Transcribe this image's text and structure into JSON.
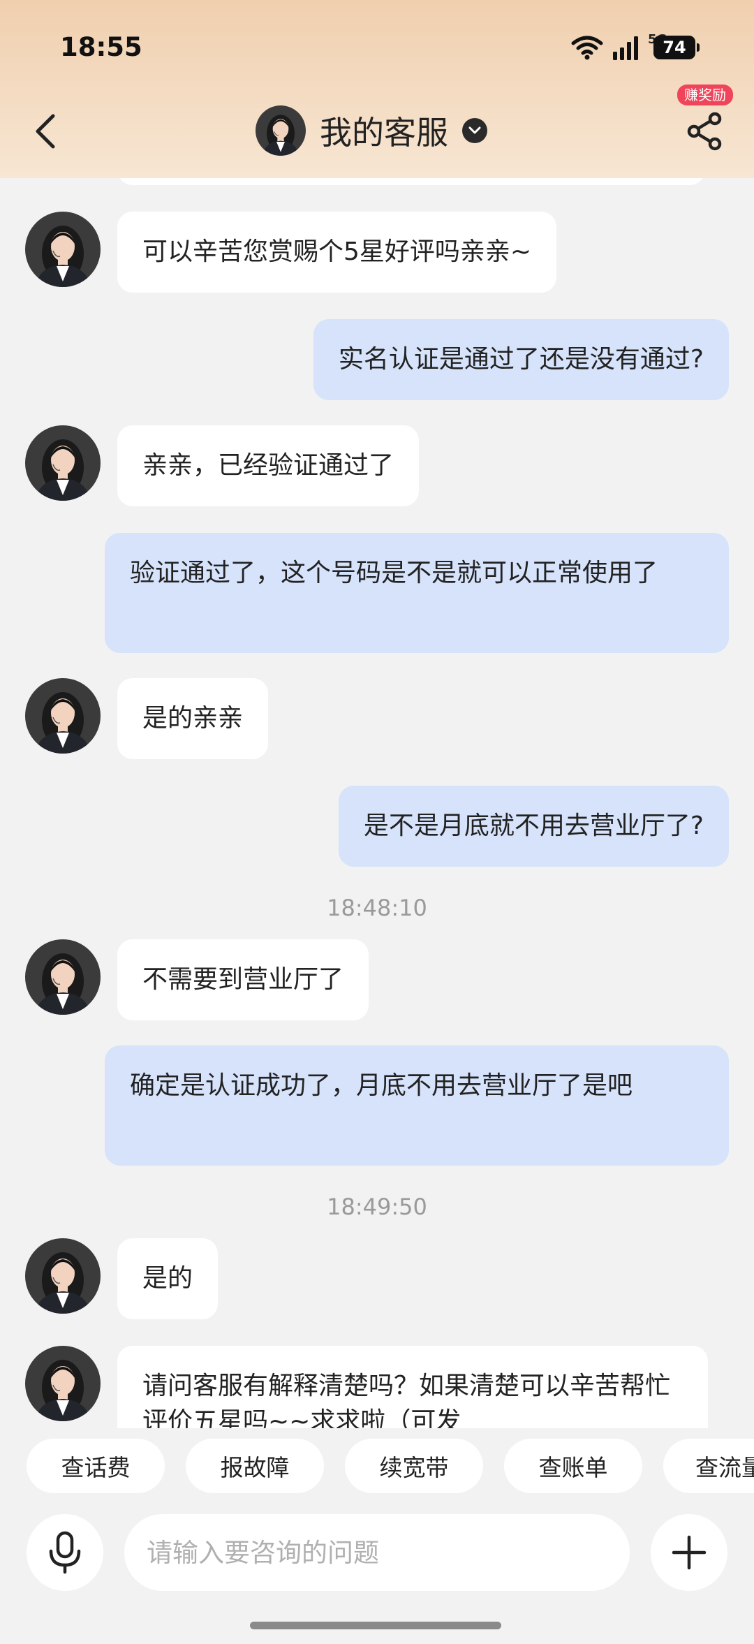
{
  "status_bar": {
    "time": "18:55",
    "network": "5G",
    "battery": "74"
  },
  "header": {
    "title": "我的客服",
    "badge": "赚奖励"
  },
  "messages": [
    {
      "side": "left",
      "text": "可以辛苦您赏赐个5星好评吗亲亲~"
    },
    {
      "side": "right",
      "text": "实名认证是通过了还是没有通过?"
    },
    {
      "side": "left",
      "text": "亲亲，已经验证通过了"
    },
    {
      "side": "right",
      "text": "验证通过了，这个号码是不是就可以正常使用了"
    },
    {
      "side": "left",
      "text": "是的亲亲"
    },
    {
      "side": "right",
      "text": "是不是月底就不用去营业厅了?"
    },
    {
      "timestamp": "18:48:10"
    },
    {
      "side": "left",
      "text": "不需要到营业厅了"
    },
    {
      "side": "right",
      "text": "确定是认证成功了，月底不用去营业厅了是吧"
    },
    {
      "timestamp": "18:49:50"
    },
    {
      "side": "left",
      "text": "是的"
    },
    {
      "side": "left",
      "text": "请问客服有解释清楚吗？如果清楚可以辛苦帮忙评价五星吗~~求求啦（可发"
    }
  ],
  "quick_actions": [
    "查话费",
    "报故障",
    "续宽带",
    "查账单",
    "查流量"
  ],
  "input": {
    "placeholder": "请输入要咨询的问题"
  },
  "icons": [
    "back-chevron-icon",
    "chevron-down-icon",
    "share-icon",
    "microphone-icon",
    "plus-icon",
    "wifi-icon",
    "signal-icon"
  ],
  "colors": {
    "user_bubble": "#d6e3fb",
    "agent_bubble": "#ffffff",
    "badge": "#f0445a",
    "background": "#f2f2f2"
  }
}
